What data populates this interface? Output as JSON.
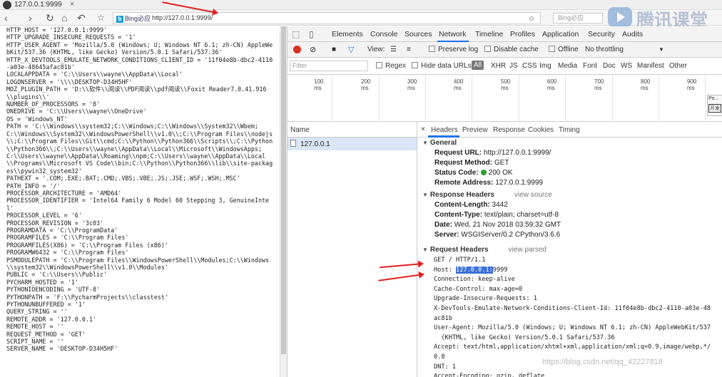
{
  "browser": {
    "tab_title": "127.0.0.1:9999",
    "search_engine": "Bing必应",
    "url": "http://127.0.0.1:9999/",
    "search_placeholder": "Bing必应",
    "watermark": "腾讯课堂"
  },
  "env_lines": [
    "HTTP_HOST = '127.0.0.1:9999'",
    "HTTP_UPGRADE_INSECURE_REQUESTS = '1'",
    "HTTP_USER_AGENT = 'Mozilla/5.0 (Windows; U; Windows NT 6.1; zh-CN) AppleWebKit/537.36 (KHTML, like Gecko) Version/5.0.1 Safari/537.36'",
    "HTTP_X_DEVTOOLS_EMULATE_NETWORK_CONDITIONS_CLIENT_ID = '11f04e8b-dbc2-4110-a03e-48645afac81b'",
    "LOCALAPPDATA = 'C:\\\\Users\\\\wayne\\\\AppData\\\\Local'",
    "LOGONSERVER = '\\\\\\\\DESKTOP-D34H5HF'",
    "MOZ_PLUGIN_PATH = 'D:\\\\软件\\\\阅读\\\\PDF阅读\\\\pdf阅读\\\\Foxit Reader7.0.41.916\\\\plugins\\\\'",
    "NUMBER_OF_PROCESSORS = '8'",
    "ONEDRIVE = 'C:\\\\Users\\\\wayne\\\\OneDrive'",
    "OS = 'Windows_NT'",
    "PATH = 'C:\\\\Windows\\\\system32;C:\\\\Windows;C:\\\\Windows\\\\System32\\\\Wbem;C:\\\\Windows\\\\System32\\\\WindowsPowerShell\\\\v1.0\\\\;C:\\\\Program Files\\\\nodejs\\\\;C:\\\\Program Files\\\\Git\\\\cmd;C:\\\\Python\\\\Python366\\\\Scripts\\\\;C:\\\\Python\\\\Python366\\\\;C:\\\\Users\\\\wayne\\\\AppData\\\\Local\\\\Microsoft\\\\WindowsApps;C:\\\\Users\\\\wayne\\\\AppData\\\\Roaming\\\\npm;C:\\\\Users\\\\wayne\\\\AppData\\\\Local\\\\Programs\\\\Microsoft VS Code\\\\bin;C:\\\\Python\\\\Python366\\\\lib\\\\site-packages\\\\pywin32_system32'",
    "PATHEXT = '.COM;.EXE;.BAT;.CMD;.VBS;.VBE;.JS;.JSE;.WSF;.WSH;.MSC'",
    "PATH_INFO = '/'",
    "PROCESSOR_ARCHITECTURE = 'AMD64'",
    "PROCESSOR_IDENTIFIER = 'Intel64 Family 6 Model 60 Stepping 3, GenuineIntel'",
    "PROCESSOR_LEVEL = '6'",
    "PROCESSOR_REVISION = '3c03'",
    "PROGRAMDATA = 'C:\\\\ProgramData'",
    "PROGRAMFILES = 'C:\\\\Program Files'",
    "PROGRAMFILES(X86) = 'C:\\\\Program Files (x86)'",
    "PROGRAMW6432 = 'C:\\\\Program Files'",
    "PSMODULEPATH = 'C:\\\\Program Files\\\\WindowsPowerShell\\\\Modules;C:\\\\Windows\\\\system32\\\\WindowsPowerShell\\\\v1.0\\\\Modules'",
    "PUBLIC = 'C:\\\\Users\\\\Public'",
    "PYCHARM_HOSTED = '1'",
    "PYTHONIOENCODING = 'UTF-8'",
    "PYTHONPATH = 'F:\\\\PycharmProjects\\\\classtest'",
    "PYTHONUNBUFFERED = '1'",
    "QUERY_STRING = ''",
    "REMOTE_ADDR = '127.0.0.1'",
    "REMOTE_HOST = ''",
    "REQUEST_METHOD = 'GET'",
    "SCRIPT_NAME = ''",
    "SERVER_NAME = 'DESKTOP-D34H5HF'"
  ],
  "devtools": {
    "tabs": [
      "Elements",
      "Console",
      "Sources",
      "Network",
      "Timeline",
      "Profiles",
      "Application",
      "Security",
      "Audits"
    ],
    "active_tab": "Network",
    "toolbar": {
      "view_label": "View:",
      "preserve_log": "Preserve log",
      "disable_cache": "Disable cache",
      "offline": "Offline",
      "throttling": "No throttling"
    },
    "filter": {
      "placeholder": "Filter",
      "regex": "Regex",
      "hide_data_urls": "Hide data URLs",
      "all": "All",
      "types": [
        "XHR",
        "JS",
        "CSS",
        "Img",
        "Media",
        "Font",
        "Doc",
        "WS",
        "Manifest",
        "Other"
      ]
    },
    "timeline_ticks": [
      "100 ms",
      "200 ms",
      "300 ms",
      "400 ms",
      "500 ms",
      "600 ms",
      "700 ms",
      "800 ms",
      "900 ms"
    ],
    "popup": {
      "text": "Po...",
      "button": "开发"
    },
    "name_header": "Name",
    "request_name": "127.0.0.1",
    "detail_tabs": [
      "Headers",
      "Preview",
      "Response",
      "Cookies",
      "Timing"
    ],
    "general": {
      "title": "General",
      "rows": [
        {
          "k": "Request URL:",
          "v": "http://127.0.0.1:9999/"
        },
        {
          "k": "Request Method:",
          "v": "GET"
        },
        {
          "k": "Status Code:",
          "v": "200 OK"
        },
        {
          "k": "Remote Address:",
          "v": "127.0.0.1:9999"
        }
      ]
    },
    "response_headers": {
      "title": "Response Headers",
      "source_link": "view source",
      "rows": [
        {
          "k": "Content-Length:",
          "v": "3442"
        },
        {
          "k": "Content-Type:",
          "v": "text/plain; charset=utf-8"
        },
        {
          "k": "Date:",
          "v": "Wed, 21 Nov 2018 03:59:32 GMT"
        },
        {
          "k": "Server:",
          "v": "WSGIServer/0.2 CPython/3.6.6"
        }
      ]
    },
    "request_headers": {
      "title": "Request Headers",
      "source_link": "view parsed",
      "line_get": "GET / HTTP/1.1",
      "host_label": "Host: ",
      "host_selected": "127.0.0.1:",
      "host_rest": "9999",
      "lines": [
        "Connection: keep-alive",
        "Cache-Control: max-age=0",
        "Upgrade-Insecure-Requests: 1",
        "X-DevTools-Emulate-Network-Conditions-Client-Id: 11f04e8b-dbc2-4110-a03e-48",
        "ac81b",
        "User-Agent: Mozilla/5.0 (Windows; U; Windows NT 6.1; zh-CN) AppleWebKit/537",
        "  (KHTML, like Gecko) Version/5.0.1 Safari/537.36",
        "Accept: text/html,application/xhtml+xml,application/xml;q=0.9,image/webp,*/",
        "0.8",
        "DNT: 1",
        "Accept-Encoding: gzip, deflate"
      ]
    }
  },
  "csdn_watermark": "https://blog.csdn.net/qq_42227818",
  "colors": {
    "accent": "#1a73e8",
    "arrow": "#e02020",
    "selection": "#3b6fd6",
    "status_ok": "#2ca02c"
  }
}
